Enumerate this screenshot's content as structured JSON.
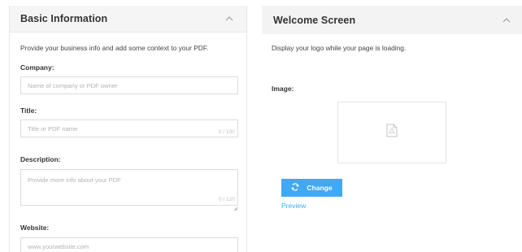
{
  "basic_info": {
    "title": "Basic Information",
    "description": "Provide your business info and add some context to your PDF.",
    "fields": {
      "company": {
        "label": "Company:",
        "placeholder": "Name of company or PDF owner",
        "value": ""
      },
      "title": {
        "label": "Title:",
        "placeholder": "Title or PDF name",
        "value": "",
        "counter": "0 / 100"
      },
      "description": {
        "label": "Description:",
        "placeholder": "Provide more info about your PDF",
        "value": "",
        "counter": "0 / 120"
      },
      "website": {
        "label": "Website:",
        "placeholder": "www.yourwebsite.com",
        "value": ""
      }
    }
  },
  "welcome_screen": {
    "title": "Welcome Screen",
    "description": "Display your logo while your page is loading.",
    "image_label": "Image:",
    "image_icon": "pdf-file-icon",
    "change_label": "Change",
    "change_icon": "refresh-icon",
    "preview_label": "Preview"
  },
  "colors": {
    "accent": "#3fa9f5",
    "header_bg": "#f5f5f5",
    "border": "#dcdcdc"
  }
}
